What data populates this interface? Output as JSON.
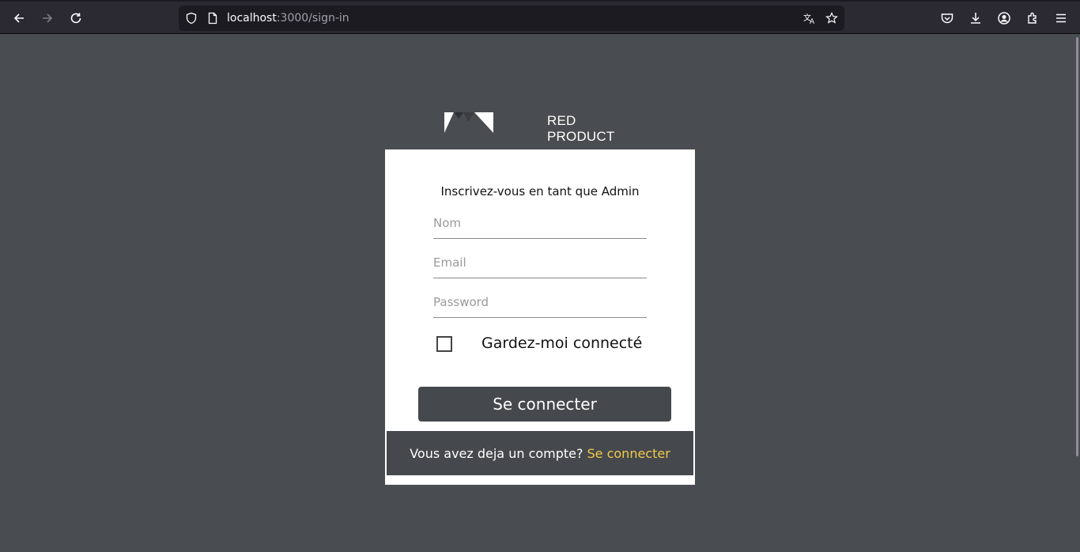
{
  "browser": {
    "url_host": "localhost",
    "url_path": ":3000/sign-in",
    "icons": {
      "back": "arrow-left-icon",
      "forward": "arrow-right-icon",
      "reload": "reload-icon",
      "shield": "shield-icon",
      "page": "page-icon",
      "translate": "translate-icon",
      "bookmark": "star-icon",
      "pocket": "pocket-icon",
      "downloads": "download-icon",
      "account": "account-icon",
      "extensions": "extensions-icon",
      "menu": "hamburger-menu-icon"
    }
  },
  "brand": {
    "name": "RED PRODUCT"
  },
  "form": {
    "title": "Inscrivez-vous en tant que Admin",
    "name_placeholder": "Nom",
    "email_placeholder": "Email",
    "password_placeholder": "Password",
    "remember_label": "Gardez-moi connecté",
    "remember_checked": false,
    "submit_label": "Se connecter"
  },
  "footer": {
    "prompt": "Vous avez deja un compte?",
    "link_label": "Se connecter"
  },
  "colors": {
    "page_background": "#494c50",
    "card_background": "#ffffff",
    "button_background": "#45484c",
    "link_accent": "#f2c94c"
  }
}
